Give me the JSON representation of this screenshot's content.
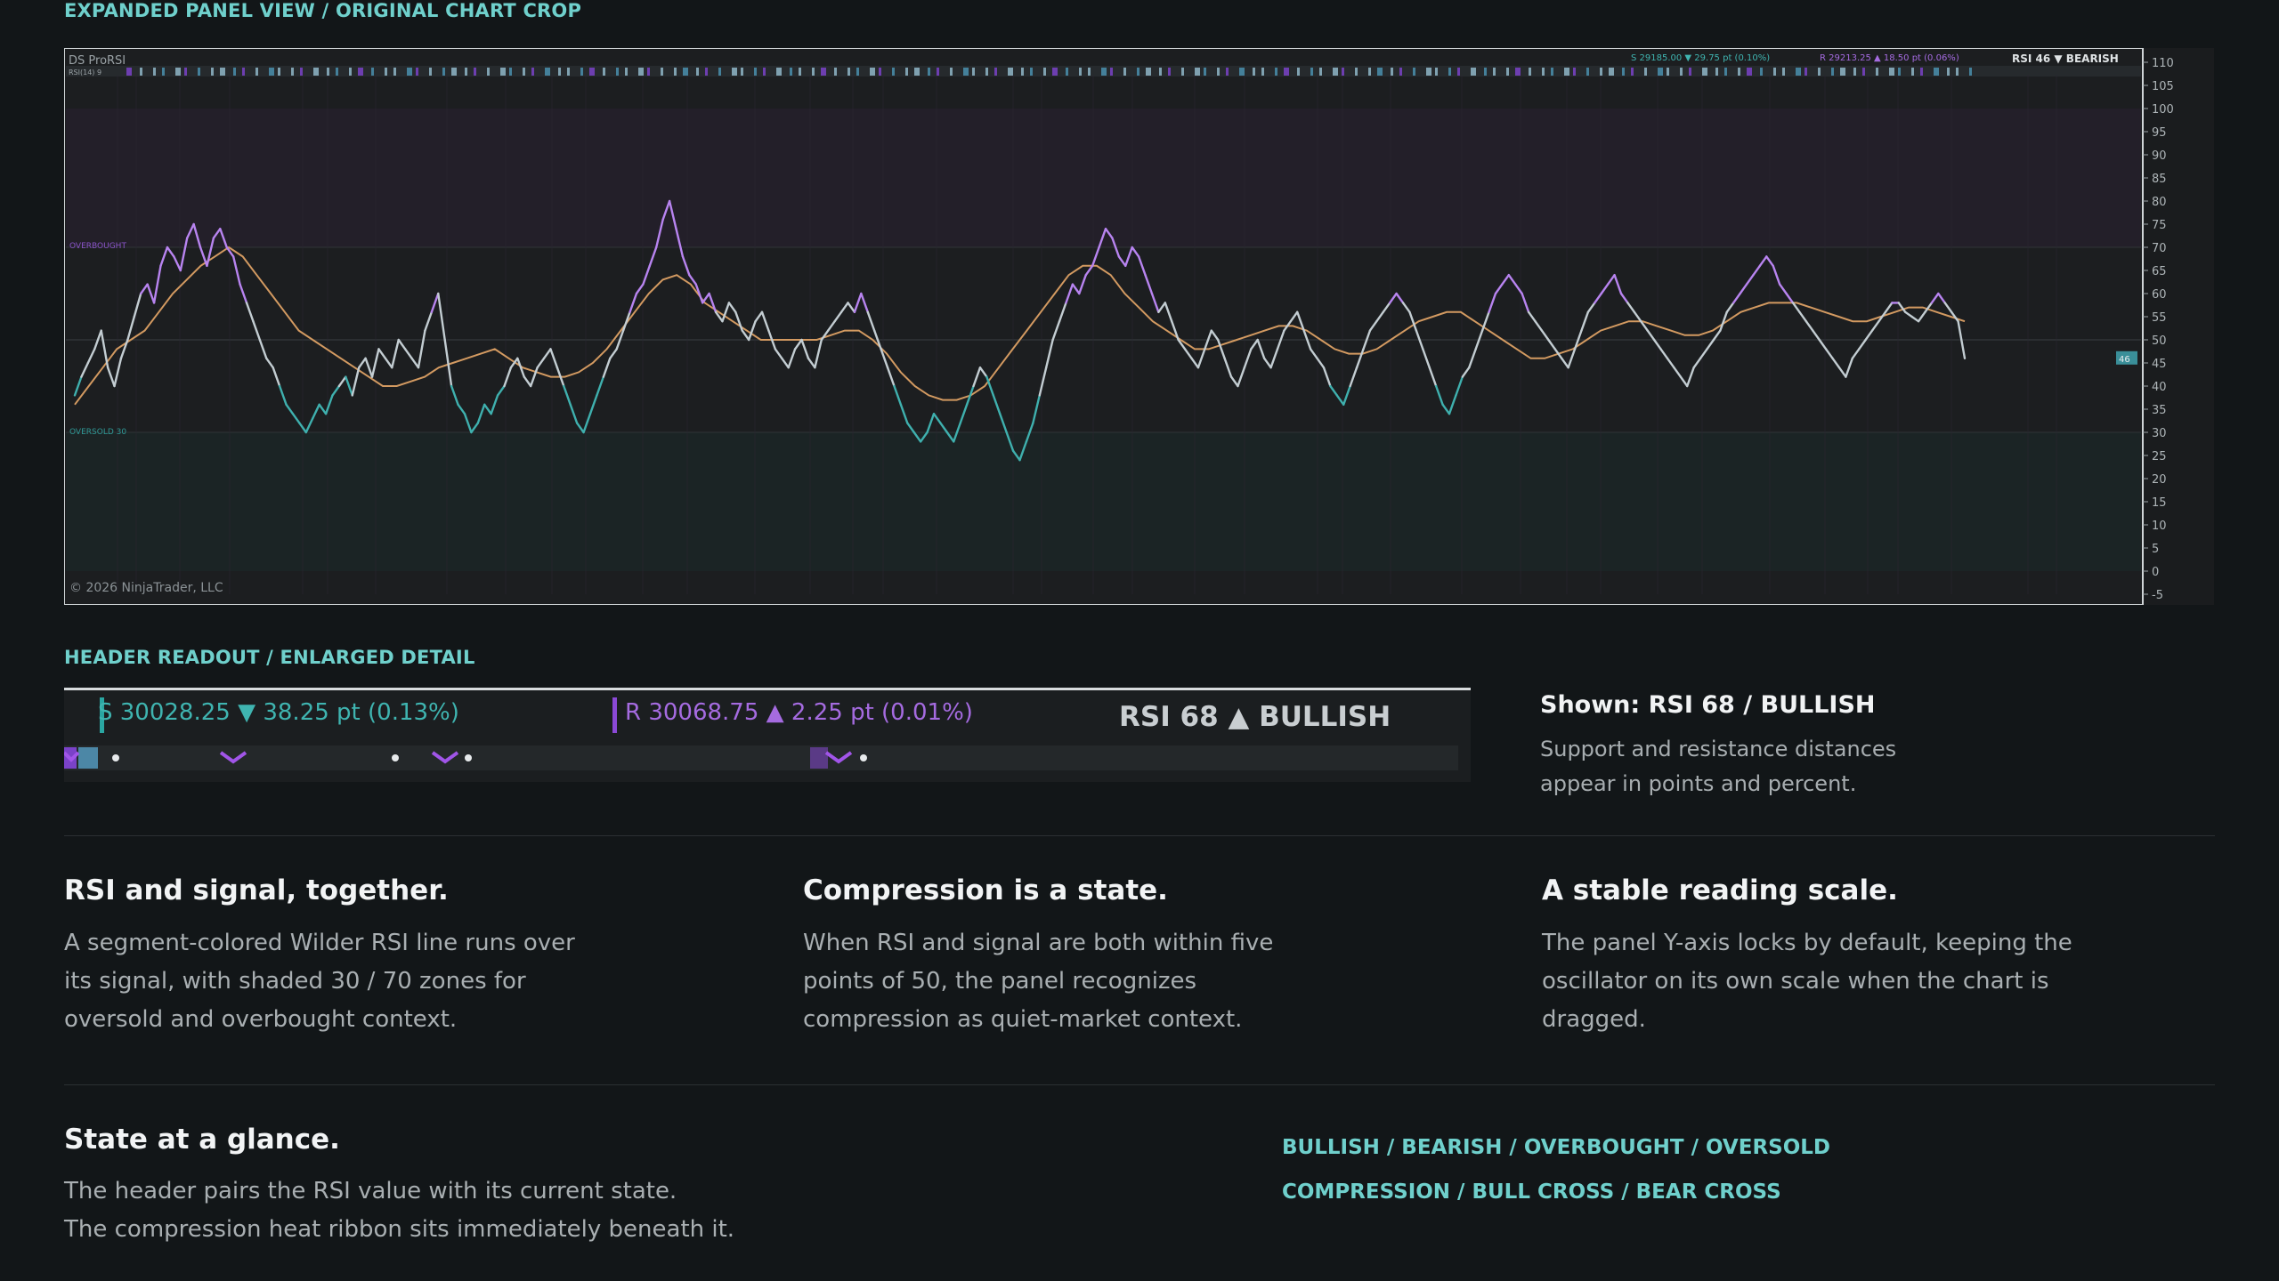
{
  "labels": {
    "panel_view": "EXPANDED PANEL VIEW / ORIGINAL CHART CROP",
    "header_readout": "HEADER READOUT / ENLARGED DETAIL"
  },
  "chart": {
    "indicator_name": "DS ProRSI",
    "indicator_sub": "RSI(14) 9",
    "overbought_label": "OVERBOUGHT",
    "oversold_label": "OVERSOLD 30",
    "copyright": "© 2026 NinjaTrader, LLC",
    "header_support": "S 29185.00 ▼ 29.75 pt (0.10%)",
    "header_resist": "R 29213.25 ▲ 18.50 pt (0.06%)",
    "header_state": "RSI 46 ▼ BEARISH",
    "last_value_tag": "46",
    "y_ticks": [
      "110",
      "105",
      "100",
      "95",
      "90",
      "85",
      "80",
      "75",
      "70",
      "65",
      "60",
      "55",
      "50",
      "45",
      "40",
      "35",
      "30",
      "25",
      "20",
      "15",
      "10",
      "5",
      "0",
      "-5"
    ],
    "colors": {
      "rsi_bull": "#b884f0",
      "rsi_neutral": "#c3cdd2",
      "rsi_bear": "#3fb0ae",
      "signal": "#d39a61",
      "overbought_zone": "#231f29",
      "oversold_zone": "#1b2425"
    }
  },
  "chart_data": {
    "type": "line",
    "ylim": [
      -5,
      110
    ],
    "reference_lines": [
      30,
      50,
      70
    ],
    "series": [
      {
        "values": [
          38,
          42,
          45,
          48,
          52,
          44,
          40,
          46,
          50,
          55,
          60,
          62,
          58,
          66,
          70,
          68,
          65,
          72,
          75,
          70,
          66,
          72,
          74,
          70,
          68,
          62,
          58,
          54,
          50,
          46,
          44,
          40,
          36,
          34,
          32,
          30,
          33,
          36,
          34,
          38,
          40,
          42,
          38,
          44,
          46,
          42,
          48,
          46,
          44,
          50,
          48,
          46,
          44,
          52,
          56,
          60,
          50,
          40,
          36,
          34,
          30,
          32,
          36,
          34,
          38,
          40,
          44,
          46,
          42,
          40,
          44,
          46,
          48,
          44,
          40,
          36,
          32,
          30,
          34,
          38,
          42,
          46,
          48,
          52,
          56,
          60,
          62,
          66,
          70,
          76,
          80,
          74,
          68,
          64,
          62,
          58,
          60,
          56,
          54,
          58,
          56,
          52,
          50,
          54,
          56,
          52,
          48,
          46,
          44,
          48,
          50,
          46,
          44,
          50,
          52,
          54,
          56,
          58,
          56,
          60,
          56,
          52,
          48,
          44,
          40,
          36,
          32,
          30,
          28,
          30,
          34,
          32,
          30,
          28,
          32,
          36,
          40,
          44,
          42,
          38,
          34,
          30,
          26,
          24,
          28,
          32,
          38,
          44,
          50,
          54,
          58,
          62,
          60,
          64,
          66,
          70,
          74,
          72,
          68,
          66,
          70,
          68,
          64,
          60,
          56,
          58,
          54,
          50,
          48,
          46,
          44,
          48,
          52,
          50,
          46,
          42,
          40,
          44,
          48,
          50,
          46,
          44,
          48,
          52,
          54,
          56,
          52,
          48,
          46,
          44,
          40,
          38,
          36,
          40,
          44,
          48,
          52,
          54,
          56,
          58,
          60,
          58,
          56,
          52,
          48,
          44,
          40,
          36,
          34,
          38,
          42,
          44,
          48,
          52,
          56,
          60,
          62,
          64,
          62,
          60,
          56,
          54,
          52,
          50,
          48,
          46,
          44,
          48,
          52,
          56,
          58,
          60,
          62,
          64,
          60,
          58,
          56,
          54,
          52,
          50,
          48,
          46,
          44,
          42,
          40,
          44,
          46,
          48,
          50,
          52,
          56,
          58,
          60,
          62,
          64,
          66,
          68,
          66,
          62,
          60,
          58,
          56,
          54,
          52,
          50,
          48,
          46,
          44,
          42,
          46,
          48,
          50,
          52,
          54,
          56,
          58,
          58,
          56,
          55,
          54,
          56,
          58,
          60,
          58,
          56,
          54,
          46
        ],
        "color_by_value": true
      },
      {
        "values": [
          36,
          40,
          44,
          48,
          50,
          52,
          56,
          60,
          63,
          66,
          68,
          70,
          68,
          64,
          60,
          56,
          52,
          50,
          48,
          46,
          44,
          42,
          40,
          40,
          41,
          42,
          44,
          45,
          46,
          47,
          48,
          46,
          44,
          43,
          42,
          42,
          43,
          45,
          48,
          52,
          56,
          60,
          63,
          64,
          62,
          58,
          56,
          54,
          52,
          50,
          50,
          50,
          50,
          50,
          51,
          52,
          52,
          50,
          47,
          43,
          40,
          38,
          37,
          37,
          38,
          40,
          44,
          48,
          52,
          56,
          60,
          64,
          66,
          66,
          64,
          60,
          57,
          54,
          52,
          50,
          48,
          48,
          49,
          50,
          51,
          52,
          53,
          53,
          52,
          50,
          48,
          47,
          47,
          48,
          50,
          52,
          54,
          55,
          56,
          56,
          54,
          52,
          50,
          48,
          46,
          46,
          47,
          48,
          50,
          52,
          53,
          54,
          54,
          53,
          52,
          51,
          51,
          52,
          54,
          56,
          57,
          58,
          58,
          58,
          57,
          56,
          55,
          54,
          54,
          55,
          56,
          57,
          57,
          56,
          55,
          54
        ]
      }
    ]
  },
  "header_detail": {
    "support": "S 30028.25  ▼ 38.25 pt (0.13%)",
    "resistance": "R 30068.75  ▲ 2.25 pt (0.01%)",
    "rsi_state": "RSI 68  ▲ BULLISH"
  },
  "shown": {
    "title": "Shown: RSI 68 / BULLISH",
    "desc": "Support and resistance distances appear in points and percent."
  },
  "features": [
    {
      "title": "RSI and signal, together.",
      "body": "A segment-colored Wilder RSI line runs over its signal, with shaded 30 / 70 zones for oversold and overbought context."
    },
    {
      "title": "Compression is a state.",
      "body": "When RSI and signal are both within five points of 50, the panel recognizes compression as quiet-market context."
    },
    {
      "title": "A stable reading scale.",
      "body": "The panel Y-axis locks by default, keeping the oscillator on its own scale when the chart is dragged."
    }
  ],
  "state": {
    "title": "State at a glance.",
    "body_1": "The header pairs the RSI value with its current state.",
    "body_2": "The compression heat ribbon sits immediately beneath it."
  },
  "states_list": {
    "line1": "BULLISH / BEARISH / OVERBOUGHT / OVERSOLD",
    "line2": "COMPRESSION / BULL CROSS / BEAR CROSS"
  }
}
